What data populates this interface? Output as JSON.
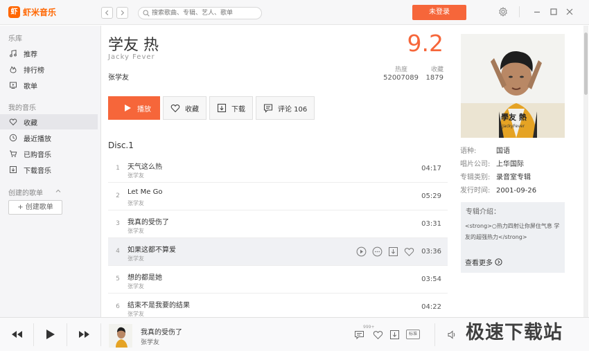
{
  "app": {
    "logo_glyph": "虾",
    "name": "虾米音乐",
    "accent": "#f6663a"
  },
  "topbar": {
    "back_icon": "chevron-left-icon",
    "forward_icon": "chevron-right-icon",
    "search_placeholder": "搜索歌曲、专辑、艺人、歌单",
    "login_label": "未登录"
  },
  "sidebar": {
    "library_title": "乐库",
    "library_items": [
      {
        "label": "推荐",
        "icon": "music-note-icon"
      },
      {
        "label": "排行榜",
        "icon": "fire-icon"
      },
      {
        "label": "歌单",
        "icon": "playlist-icon"
      }
    ],
    "my_music_title": "我的音乐",
    "my_items": [
      {
        "label": "收藏",
        "icon": "heart-icon",
        "active": true
      },
      {
        "label": "最近播放",
        "icon": "clock-icon"
      },
      {
        "label": "已购音乐",
        "icon": "cart-icon"
      },
      {
        "label": "下载音乐",
        "icon": "download-icon"
      }
    ],
    "created_title": "创建的歌单",
    "create_button": "+ 创建歌单"
  },
  "album": {
    "title": "学友 热",
    "subtitle": "Jacky Fever",
    "artist": "张学友",
    "score": "9.2",
    "heat_label": "热度",
    "heat_value": "52007089",
    "fav_label": "收藏",
    "fav_value": "1879"
  },
  "actions": {
    "play": "播放",
    "collect": "收藏",
    "download": "下载",
    "comment": "评论 106"
  },
  "disc_label": "Disc.1",
  "tracks": [
    {
      "num": "1",
      "name": "天气这么热",
      "artist": "张学友",
      "duration": "04:17"
    },
    {
      "num": "2",
      "name": "Let Me Go",
      "artist": "张学友",
      "duration": "05:29"
    },
    {
      "num": "3",
      "name": "我真的受伤了",
      "artist": "张学友",
      "duration": "03:31"
    },
    {
      "num": "4",
      "name": "如果这都不算爱",
      "artist": "张学友",
      "duration": "03:36"
    },
    {
      "num": "5",
      "name": "想的都是她",
      "artist": "张学友",
      "duration": "03:54"
    },
    {
      "num": "6",
      "name": "结束不是我要的结果",
      "artist": "张学友",
      "duration": "04:22"
    }
  ],
  "details": {
    "cover_title": "學友 熱",
    "cover_sub": "JackyFever",
    "language_key": "语种:",
    "language_val": "国语",
    "label_key": "唱片公司:",
    "label_val": "上华国际",
    "type_key": "专辑类别:",
    "type_val": "录音室专辑",
    "date_key": "发行时间:",
    "date_val": "2001-09-26",
    "intro_title": "专辑介绍：",
    "intro_text": "<strong>○热力四射让你屏住气息 学友的超强热力</strong>",
    "more": "查看更多"
  },
  "player": {
    "song": "我真的受伤了",
    "artist": "张学友",
    "comment_badge": "999+",
    "quality": "标准"
  },
  "watermark": "极速下载站"
}
